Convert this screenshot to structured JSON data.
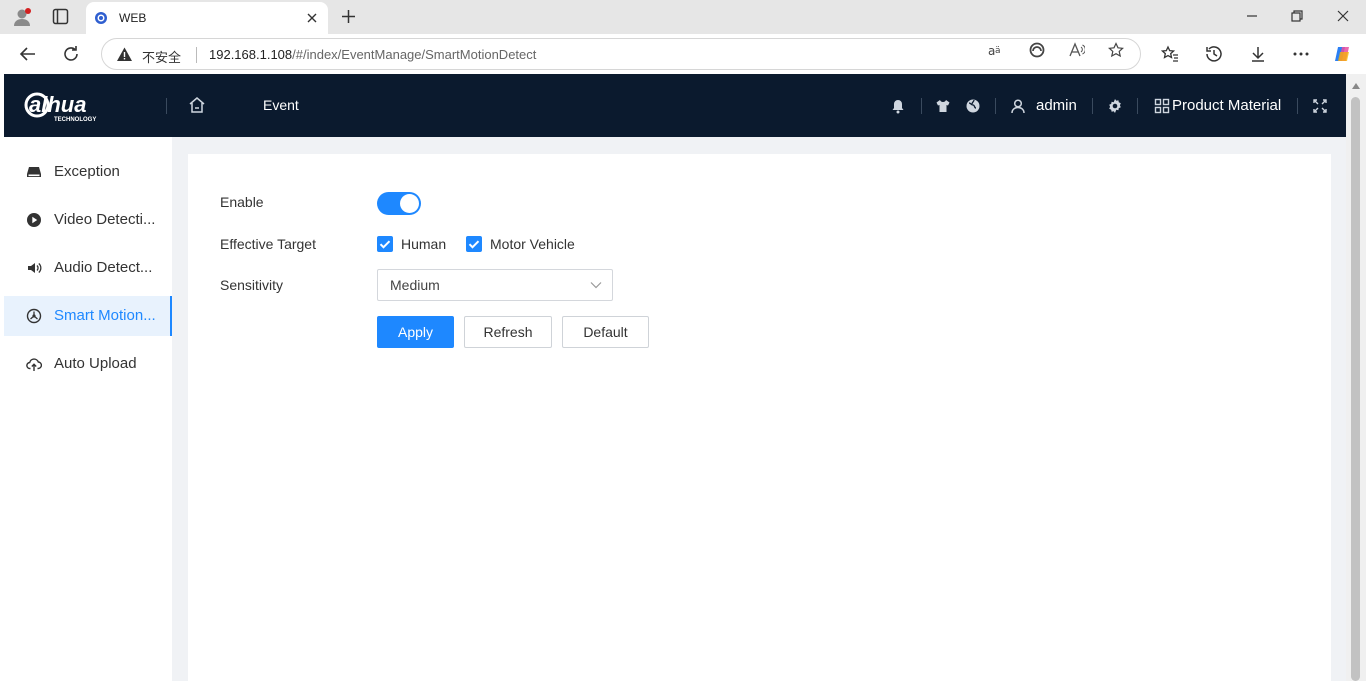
{
  "browser": {
    "tab_title": "WEB",
    "security_label": "不安全",
    "url_host": "192.168.1.108",
    "url_path": "/#/index/EventManage/SmartMotionDetect"
  },
  "header": {
    "logo_text": "alhua",
    "logo_sub": "TECHNOLOGY",
    "section": "Event",
    "user": "admin",
    "product_material": "Product Material"
  },
  "sidebar": {
    "items": [
      {
        "label": "Exception",
        "icon": "hdd-icon"
      },
      {
        "label": "Video Detecti...",
        "icon": "play-circle-icon"
      },
      {
        "label": "Audio Detect...",
        "icon": "speaker-icon"
      },
      {
        "label": "Smart Motion...",
        "icon": "smart-motion-icon",
        "active": true
      },
      {
        "label": "Auto Upload",
        "icon": "cloud-upload-icon"
      }
    ]
  },
  "form": {
    "enable_label": "Enable",
    "enable_on": true,
    "target_label": "Effective Target",
    "target_human": "Human",
    "target_human_checked": true,
    "target_vehicle": "Motor Vehicle",
    "target_vehicle_checked": true,
    "sensitivity_label": "Sensitivity",
    "sensitivity_value": "Medium"
  },
  "buttons": {
    "apply": "Apply",
    "refresh": "Refresh",
    "default": "Default"
  },
  "colors": {
    "accent": "#1e88ff",
    "header_bg": "#0b1a2e"
  }
}
